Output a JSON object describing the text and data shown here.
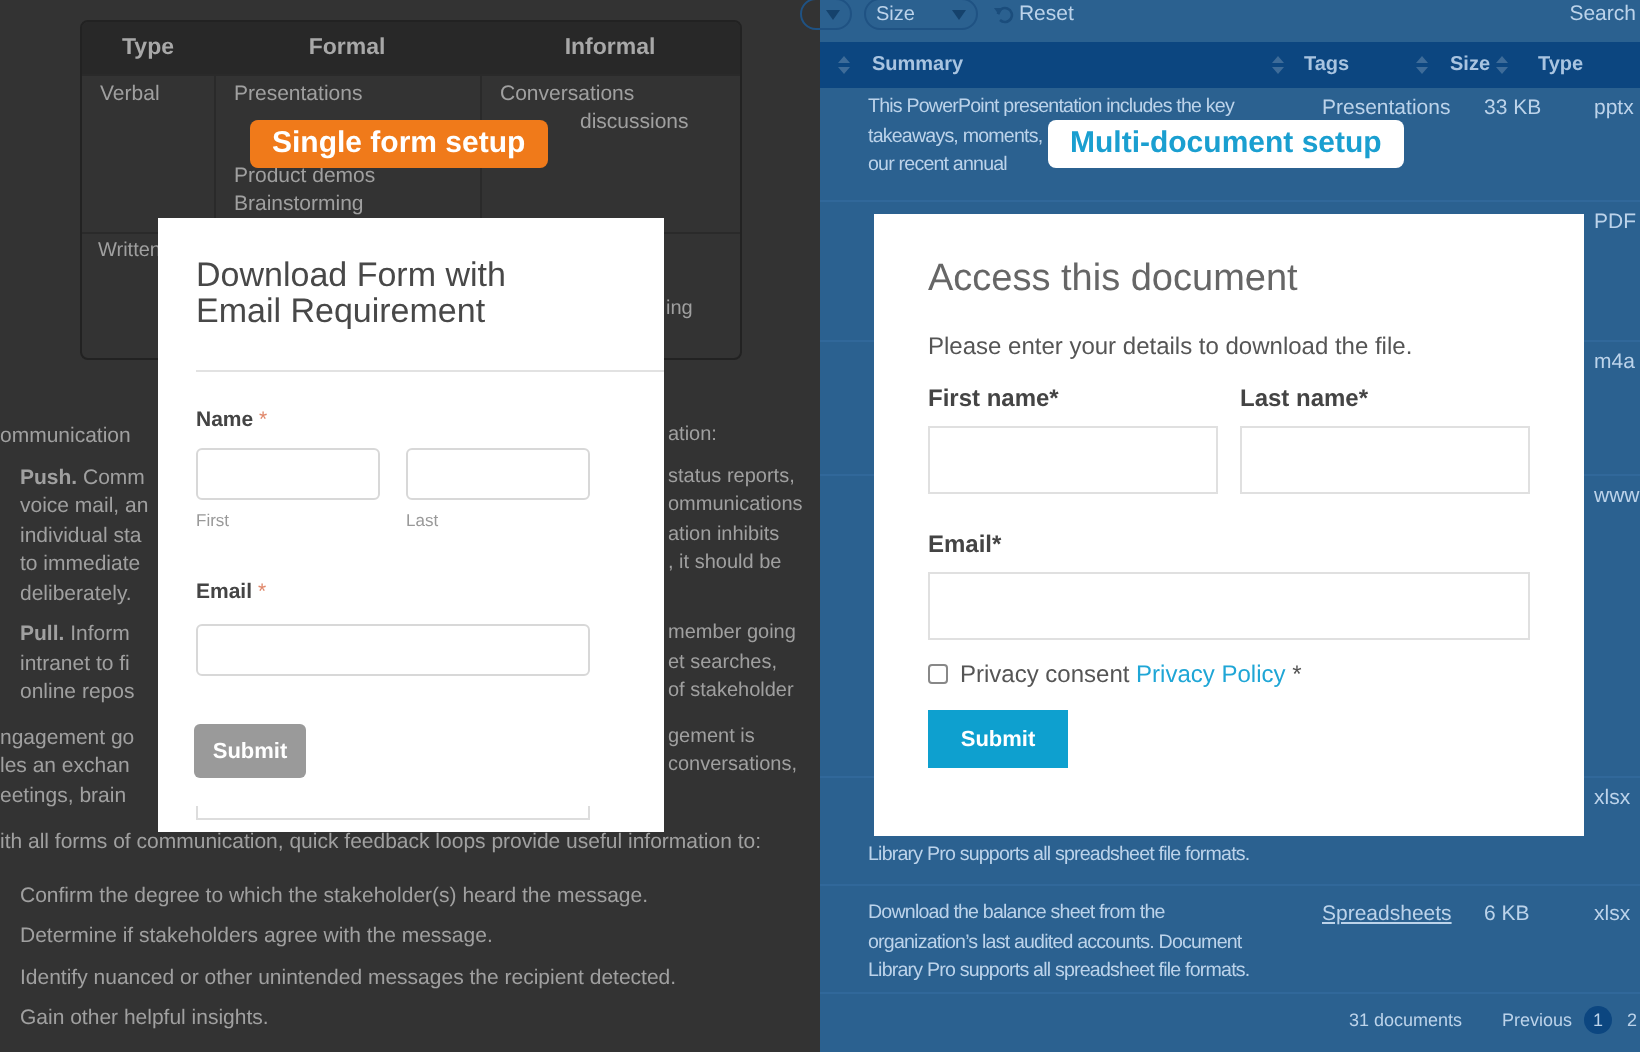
{
  "single_form_panel": {
    "table": {
      "columns": [
        "Type",
        "Formal",
        "Informal"
      ],
      "rows": [
        {
          "type": "Verbal",
          "formal": [
            "Presentations",
            "Product demos",
            "Brainstorming"
          ],
          "informal": [
            "Conversations",
            "discussions"
          ]
        },
        {
          "type": "Written",
          "formal": [],
          "informal": [
            "ing"
          ]
        }
      ]
    },
    "badge": "Single form setup",
    "paragraphs": [
      {
        "kind": "body",
        "lines": [
          {
            "left": "ommunication",
            "right": "ation:"
          }
        ]
      },
      {
        "kind": "indented",
        "lines": [
          {
            "left": "**Push.** Comm",
            "right": "status reports,"
          },
          {
            "left": "voice mail, an",
            "right": "ommunications"
          },
          {
            "left": "individual sta",
            "right": "ation inhibits"
          },
          {
            "left": "to immediate",
            "right": ", it should be"
          },
          {
            "left": "deliberately."
          }
        ]
      },
      {
        "kind": "indented",
        "lines": [
          {
            "left": "**Pull.** Inform",
            "right": "member going"
          },
          {
            "left": "intranet to fi",
            "right": "et searches,"
          },
          {
            "left": "online repos",
            "right": "of stakeholder"
          }
        ]
      },
      {
        "kind": "body",
        "lines": [
          {
            "left": "ngagement go",
            "right": "gement is"
          },
          {
            "left": "les an exchan",
            "right": "conversations,"
          },
          {
            "left": "eetings, brain"
          }
        ]
      },
      {
        "kind": "body",
        "lines": [
          {
            "left": "ith all forms of communication, quick feedback loops provide useful information to:"
          }
        ]
      },
      {
        "kind": "indented",
        "lines": [
          {
            "left": "Confirm the degree to which the stakeholder(s) heard the message."
          },
          {
            "left": "Determine if stakeholders agree with the message."
          },
          {
            "left": "Identify nuanced or other unintended messages the recipient detected."
          },
          {
            "left": "Gain other helpful insights."
          }
        ]
      }
    ],
    "form": {
      "title": "Download Form with Email Requirement",
      "name_field": {
        "label": "Name",
        "required_mark": "*",
        "sublabels": [
          "First",
          "Last"
        ]
      },
      "email_field": {
        "label": "Email",
        "required_mark": "*"
      },
      "submit": {
        "label": "Submit",
        "disabled": true
      }
    }
  },
  "multi_document_panel": {
    "toolbar": {
      "filter": "Size",
      "reset": "Reset",
      "search_label": "Search"
    },
    "columns": [
      "Summary",
      "Tags",
      "Size",
      "Type"
    ],
    "rows": [
      {
        "summary": [
          "This PowerPoint presentation includes the key",
          "takeaways, moments,",
          "our recent annual"
        ],
        "tag": "Presentations",
        "size": "33 KB",
        "type": "pptx"
      },
      {
        "summary": [],
        "type": "PDF"
      },
      {
        "summary": [],
        "type": "m4a"
      },
      {
        "summary": [],
        "type": "www"
      },
      {
        "summary": [
          "Library Pro supports all spreadsheet file formats."
        ],
        "type": "xlsx"
      },
      {
        "summary": [
          "Download the balance sheet from the",
          "organization’s last audited accounts. Document",
          "Library Pro supports all spreadsheet file formats."
        ],
        "tag": "Spreadsheets",
        "size": "6 KB",
        "type": "xlsx"
      }
    ],
    "footer": {
      "count": "31 documents",
      "previous": "Previous",
      "pages": [
        {
          "label": "1",
          "selected": true
        },
        {
          "label": "2",
          "selected": false
        }
      ]
    },
    "badge": "Multi-document setup",
    "form": {
      "title": "Access this document",
      "description": "Please enter your details to download the file.",
      "first_name_label": "First name*",
      "last_name_label": "Last name*",
      "email_label": "Email*",
      "consent": {
        "label": "Privacy consent",
        "link": "Privacy Policy",
        "required_mark": "*",
        "checked": false
      },
      "submit": {
        "label": "Submit",
        "disabled": false
      }
    }
  }
}
